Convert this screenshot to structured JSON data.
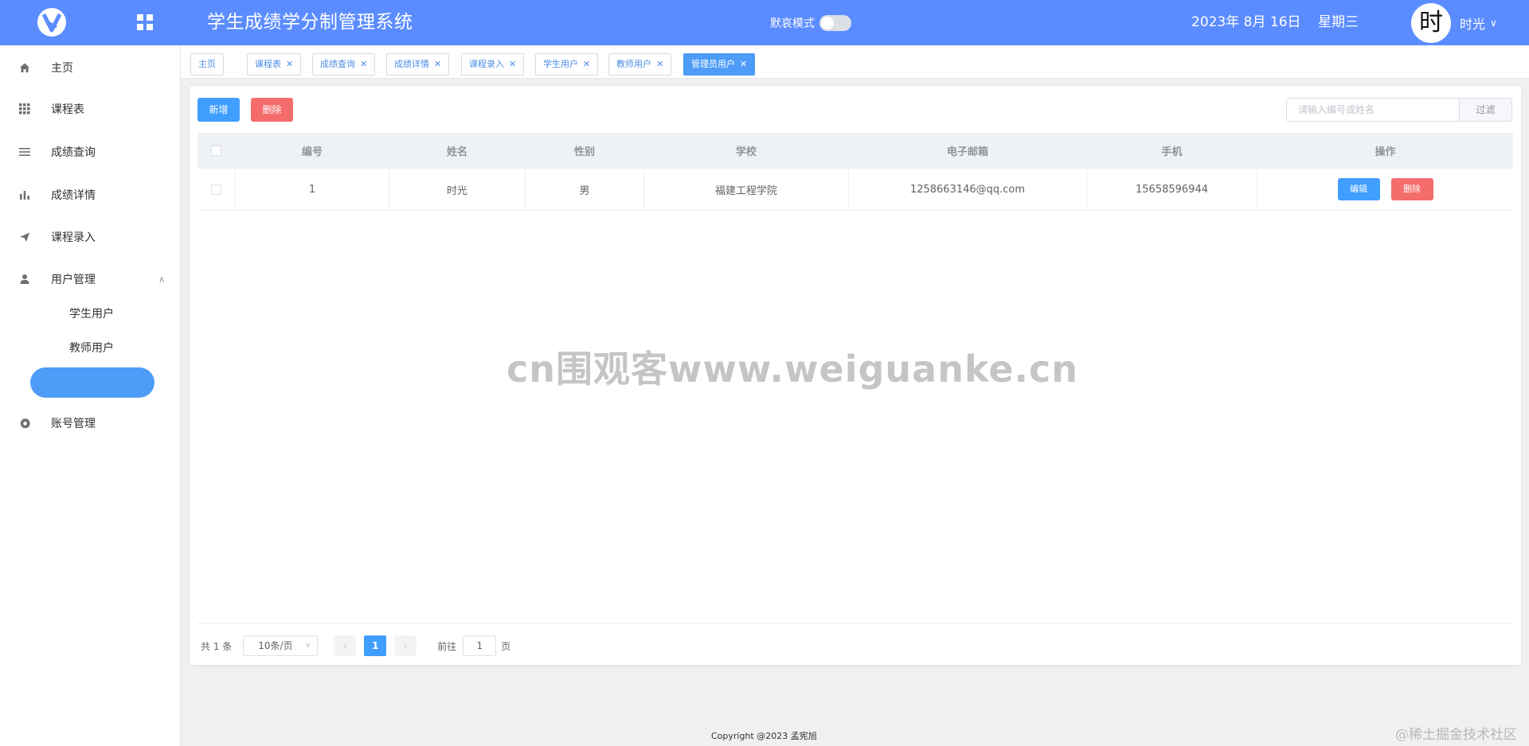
{
  "header": {
    "title": "学生成绩学分制管理系统",
    "mode_label": "默哀模式",
    "date": "2023年 8月 16日    星期三",
    "avatar_char": "时",
    "username": "时光"
  },
  "sidebar": {
    "items": [
      {
        "label": "主页",
        "icon": "home-icon"
      },
      {
        "label": "课程表",
        "icon": "grid-icon"
      },
      {
        "label": "成绩查询",
        "icon": "list-icon"
      },
      {
        "label": "成绩详情",
        "icon": "bar-chart-icon"
      },
      {
        "label": "课程录入",
        "icon": "send-icon"
      },
      {
        "label": "用户管理",
        "icon": "user-icon"
      },
      {
        "label": "账号管理",
        "icon": "gear-icon"
      }
    ],
    "sub_items": [
      "学生用户",
      "教师用户"
    ]
  },
  "tabs": [
    {
      "label": "主页",
      "closable": false
    },
    {
      "label": "课程表",
      "closable": true
    },
    {
      "label": "成绩查询",
      "closable": true
    },
    {
      "label": "成绩详情",
      "closable": true
    },
    {
      "label": "课程录入",
      "closable": true
    },
    {
      "label": "学生用户",
      "closable": true
    },
    {
      "label": "教师用户",
      "closable": true
    },
    {
      "label": "管理员用户",
      "closable": true,
      "active": true
    }
  ],
  "toolbar": {
    "add_label": "新增",
    "delete_label": "删除",
    "search_placeholder": "请输入编号或姓名",
    "filter_label": "过滤"
  },
  "table": {
    "columns": [
      "编号",
      "姓名",
      "性别",
      "学校",
      "电子邮箱",
      "手机",
      "操作"
    ],
    "rows": [
      {
        "id": "1",
        "name": "时光",
        "gender": "男",
        "school": "福建工程学院",
        "email": "1258663146@qq.com",
        "phone": "15658596944"
      }
    ],
    "edit_label": "编辑",
    "delete_label": "删除"
  },
  "pagination": {
    "total": "共 1 条",
    "page_size": "10条/页",
    "current_page": "1",
    "goto_prefix": "前往",
    "goto_value": "1",
    "goto_suffix": "页"
  },
  "footer": "Copyright @2023 孟宪旭",
  "watermark": "cn围观客www.weiguanke.cn",
  "corner_mark": "@稀土掘金技术社区",
  "colors": {
    "header": "#5b8cff",
    "primary": "#409eff",
    "danger": "#f56c6c"
  }
}
